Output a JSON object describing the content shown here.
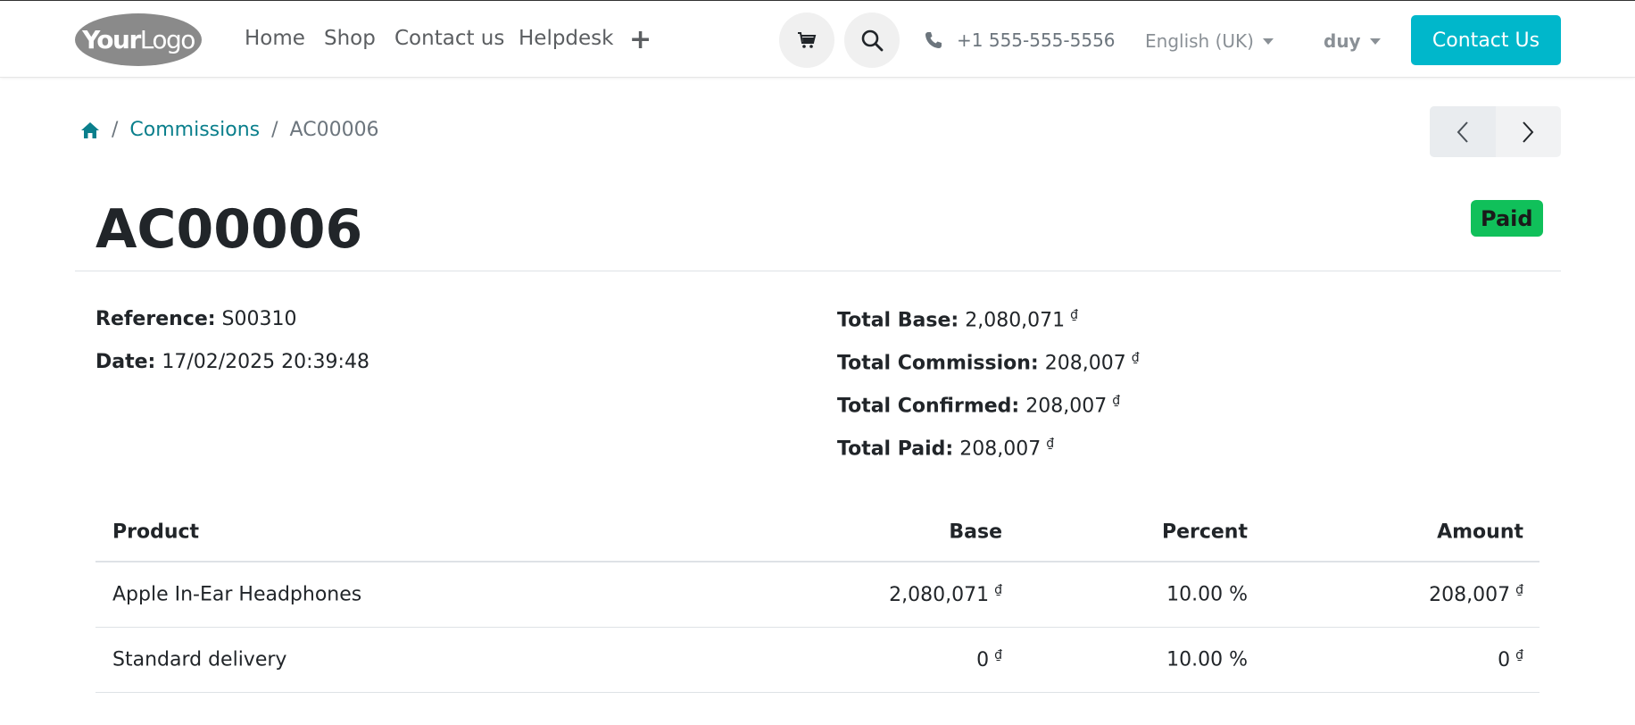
{
  "header": {
    "logo": {
      "bold": "Your",
      "thin": "Logo"
    },
    "nav": [
      "Home",
      "Shop",
      "Contact us",
      "Helpdesk"
    ],
    "add_icon": "plus-icon",
    "cart_icon": "shopping-cart-icon",
    "search_icon": "search-icon",
    "phone": "+1 555-555-5556",
    "language": "English (UK)",
    "user": "duy",
    "cta": "Contact Us",
    "accent_color": "#00b7cb"
  },
  "breadcrumb": {
    "home_icon": "home-icon",
    "items": [
      "Commissions",
      "AC00006"
    ]
  },
  "record": {
    "title": "AC00006",
    "status": "Paid",
    "status_color": "#10c05a",
    "left_fields": [
      {
        "label": "Reference:",
        "value": "S00310"
      },
      {
        "label": "Date:",
        "value": "17/02/2025 20:39:48"
      }
    ],
    "right_fields": [
      {
        "label": "Total Base:",
        "value": "2,080,071",
        "currency": "₫"
      },
      {
        "label": "Total Commission:",
        "value": "208,007",
        "currency": "₫"
      },
      {
        "label": "Total Confirmed:",
        "value": "208,007",
        "currency": "₫"
      },
      {
        "label": "Total Paid:",
        "value": "208,007",
        "currency": "₫"
      }
    ]
  },
  "table": {
    "columns": [
      "Product",
      "Base",
      "Percent",
      "Amount"
    ],
    "rows": [
      {
        "product": "Apple In-Ear Headphones",
        "base": "2,080,071",
        "percent": "10.00 %",
        "amount": "208,007",
        "currency": "₫"
      },
      {
        "product": "Standard delivery",
        "base": "0",
        "percent": "10.00 %",
        "amount": "0",
        "currency": "₫"
      }
    ]
  }
}
